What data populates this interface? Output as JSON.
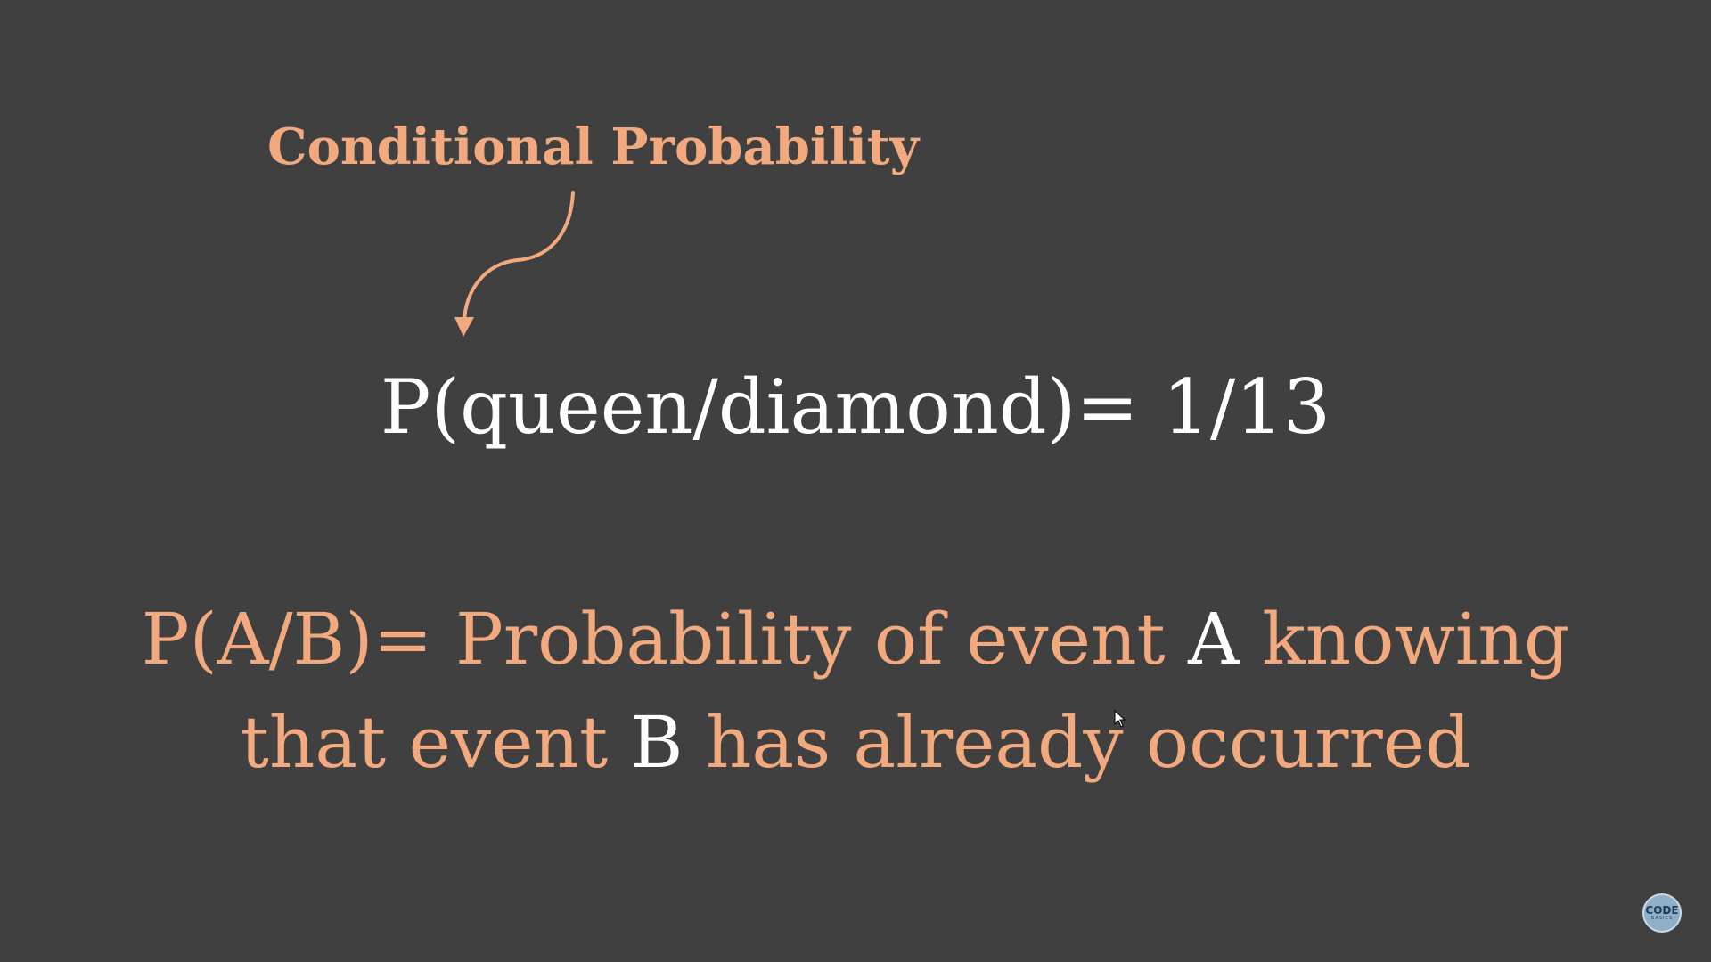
{
  "slide": {
    "heading": "Conditional Probability",
    "formula": "P(queen/diamond)= 1/13",
    "definition": {
      "line1_part1": "P(A/B)= Probability of event ",
      "line1_event_a": "A",
      "line1_part2": " knowing",
      "line2_part1": "that event ",
      "line2_event_b": "B",
      "line2_part2": " has already occurred"
    }
  },
  "logo": {
    "main": "CODE",
    "sub": "BASICS"
  },
  "colors": {
    "background": "#404040",
    "accent": "#f2a97e",
    "text": "#ffffff"
  },
  "icons": [
    "curved-arrow-icon",
    "mouse-cursor-icon",
    "codebasics-logo"
  ]
}
